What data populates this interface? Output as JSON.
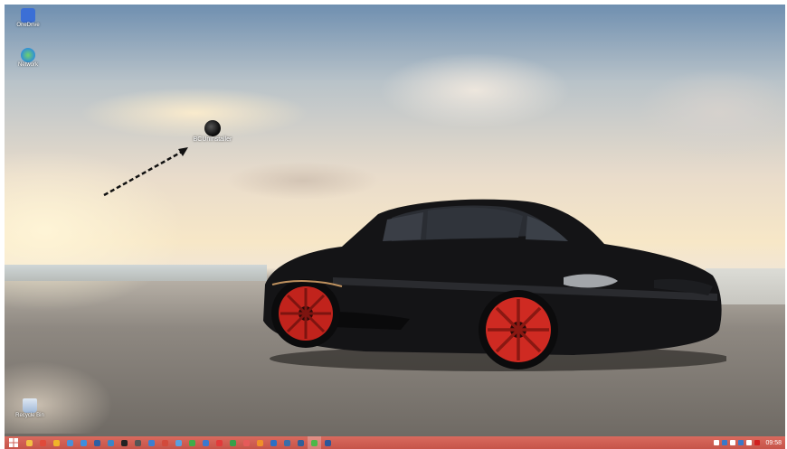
{
  "desktop": {
    "icons": [
      {
        "label": "OneDrive",
        "icon": "this-pc-icon",
        "color": "#3b6fd6"
      },
      {
        "label": "Network",
        "icon": "network-globe-icon",
        "color": "#2f8fd8"
      },
      {
        "label": "Recycle Bin",
        "icon": "recycle-bin-icon",
        "color": "#9fb7d6"
      }
    ],
    "highlight": {
      "label": "BCUninstaller",
      "icon": "bcuninstaller-icon"
    }
  },
  "taskbar": {
    "accent": "#c65449",
    "pinned": [
      {
        "icon": "file-explorer-icon",
        "color": "#f3c044"
      },
      {
        "icon": "store-icon",
        "color": "#e04a3a"
      },
      {
        "icon": "chrome-icon",
        "color": "#f0b429"
      },
      {
        "icon": "media-icon",
        "color": "#4a90d9"
      },
      {
        "icon": "ie-icon",
        "color": "#3e8ede"
      },
      {
        "icon": "app-icon",
        "color": "#2d5fa3"
      },
      {
        "icon": "photos-icon",
        "color": "#3a86c8"
      },
      {
        "icon": "steam-icon",
        "color": "#222222"
      },
      {
        "icon": "app-icon-2",
        "color": "#555555"
      },
      {
        "icon": "bluetooth-icon",
        "color": "#3c7fd0"
      },
      {
        "icon": "tool-icon",
        "color": "#d24a3b"
      },
      {
        "icon": "app-icon-3",
        "color": "#5aa0e0"
      },
      {
        "icon": "green-app-icon",
        "color": "#3fae49"
      },
      {
        "icon": "blue-app-icon",
        "color": "#3b78d0"
      },
      {
        "icon": "red-app-icon",
        "color": "#e23a3a"
      },
      {
        "icon": "green-app-icon-2",
        "color": "#36a14a"
      },
      {
        "icon": "pinwheel-icon",
        "color": "#e55a5a"
      },
      {
        "icon": "orange-app-icon",
        "color": "#f0902a"
      },
      {
        "icon": "blue-app-icon-2",
        "color": "#2d6fc4"
      },
      {
        "icon": "app-icon-4",
        "color": "#3a6ea8"
      },
      {
        "icon": "monitor-icon",
        "color": "#2f5f9a"
      },
      {
        "icon": "green-app-icon-3",
        "color": "#4cb848"
      },
      {
        "icon": "word-icon",
        "color": "#2b579a"
      }
    ],
    "active_index": 21,
    "tray_icons": [
      {
        "icon": "chevron-up-icon",
        "color": "#ffffff"
      },
      {
        "icon": "network-icon",
        "color": "#3a78c8"
      },
      {
        "icon": "flag-icon",
        "color": "#ffffff"
      },
      {
        "icon": "volume-icon",
        "color": "#3a78c8"
      },
      {
        "icon": "keyboard-icon",
        "color": "#ffffff"
      },
      {
        "icon": "security-icon",
        "color": "#d11f1f"
      }
    ],
    "clock": "09:58"
  }
}
